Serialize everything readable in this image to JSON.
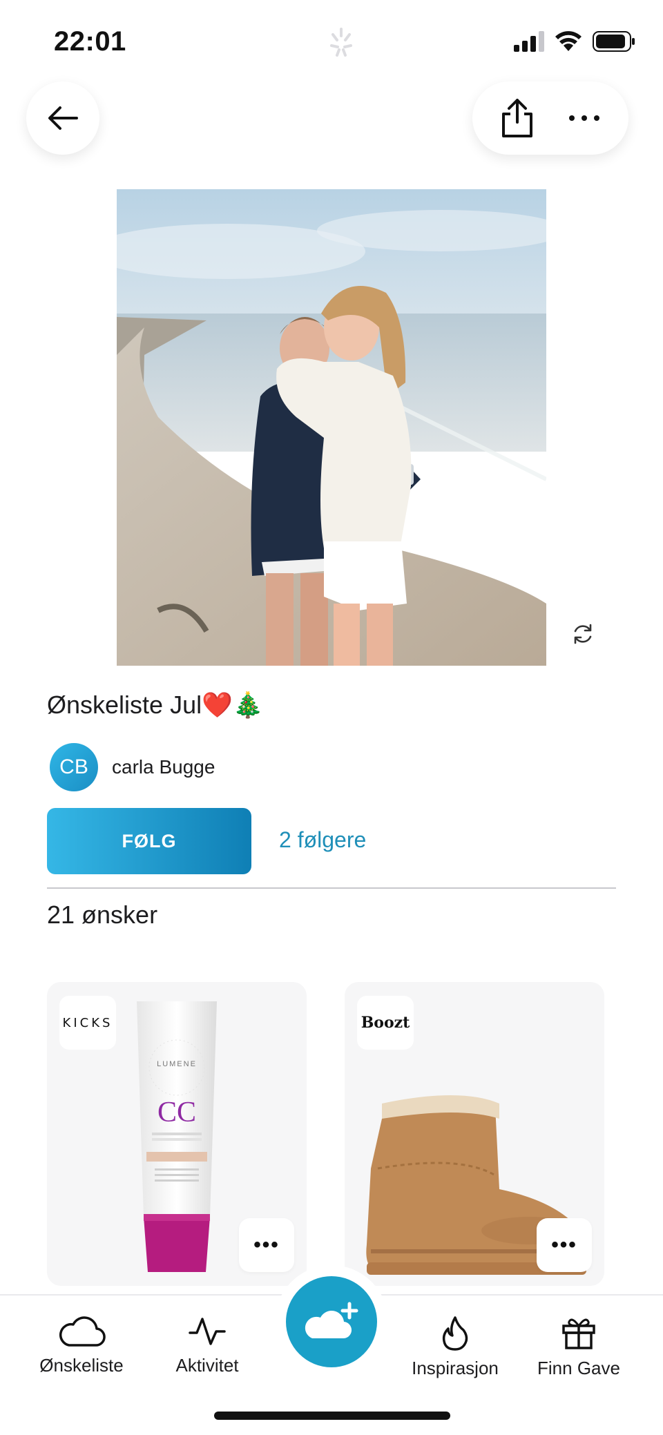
{
  "status_bar": {
    "time": "22:01"
  },
  "header": {
    "back_icon": "arrow-left-icon",
    "share_icon": "share-icon",
    "more_icon": "more-horizontal-icon"
  },
  "wishlist": {
    "title": "Ønskeliste Jul❤️🎄",
    "owner_initials": "CB",
    "owner_name": "carla Bugge",
    "follow_label": "FØLG",
    "followers_label": "2 følgere",
    "wish_count_label": "21 ønsker"
  },
  "products": [
    {
      "store": "KICKS",
      "brand_text": "LUMENE",
      "product_text": "CC",
      "more_label": "•••"
    },
    {
      "store": "Boozt",
      "more_label": "•••"
    }
  ],
  "tabs": [
    {
      "label": "Ønskeliste",
      "icon": "cloud-icon"
    },
    {
      "label": "Aktivitet",
      "icon": "activity-icon"
    },
    {
      "label": "Inspirasjon",
      "icon": "flame-icon"
    },
    {
      "label": "Finn Gave",
      "icon": "gift-icon"
    }
  ],
  "fab": {
    "icon": "cloud-plus-icon"
  },
  "colors": {
    "accent": "#1aa0c8",
    "link": "#1f8fb8",
    "avatar": "#2fb6e6"
  }
}
